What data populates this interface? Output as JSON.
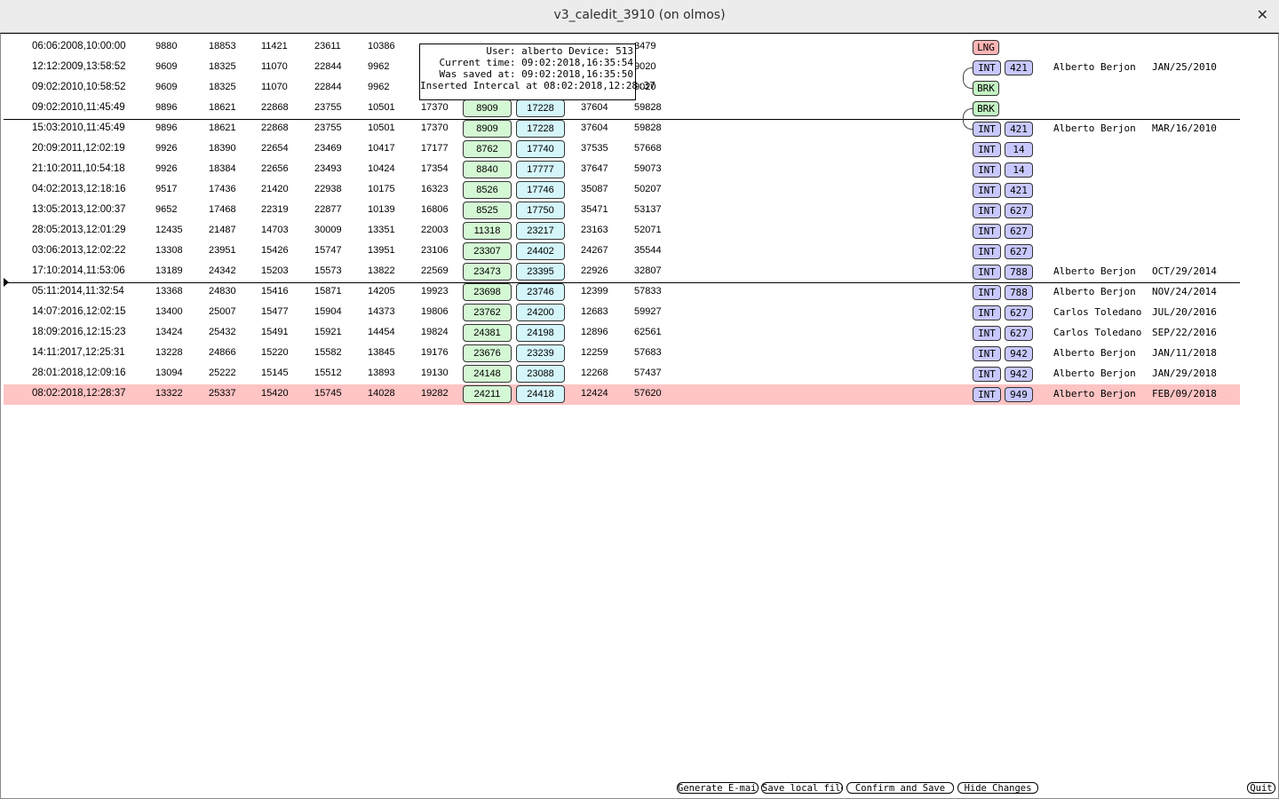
{
  "window": {
    "title": "v3_caledit_3910 (on olmos)",
    "close_glyph": "✕"
  },
  "tooltip": {
    "lines": [
      "User: alberto Device: 513",
      "Current time: 09:02:2018,16:35:54",
      "Was saved at: 09:02:2018,16:35:50",
      "Inserted Intercal at 08:02:2018,12:28:37"
    ]
  },
  "colors": {
    "selected_row": "#ffc4c4",
    "col6_box": "#d4f7d4",
    "col7_box": "#d4f5fa",
    "int_tag": "#c8c8ff",
    "lng_tag": "#ffb5b5",
    "brk_tag": "#c4f4c4"
  },
  "rows": [
    {
      "date": "06:06:2008,10:00:00",
      "vals": [
        "9880",
        "18853",
        "11421",
        "23611",
        "10386",
        "",
        "",
        "",
        "",
        "3479"
      ],
      "type": "LNG",
      "device": "",
      "user": "",
      "created": ""
    },
    {
      "date": "12:12:2009,13:58:52",
      "vals": [
        "9609",
        "18325",
        "11070",
        "22844",
        "9962",
        "",
        "",
        "",
        "",
        "9020"
      ],
      "type": "INT",
      "device": "421",
      "user": "Alberto Berjon",
      "created": "JAN/25/2010"
    },
    {
      "date": "09:02:2010,10:58:52",
      "vals": [
        "9609",
        "18325",
        "11070",
        "22844",
        "9962",
        "",
        "",
        "",
        "",
        "9020"
      ],
      "type": "BRK",
      "device": "",
      "user": "",
      "created": ""
    },
    {
      "date": "09:02:2010,11:45:49",
      "vals": [
        "9896",
        "18621",
        "22868",
        "23755",
        "10501",
        "17370",
        "8909",
        "17228",
        "37604",
        "59828"
      ],
      "type": "BRK",
      "device": "",
      "user": "",
      "created": ""
    },
    {
      "date": "15:03:2010,11:45:49",
      "vals": [
        "9896",
        "18621",
        "22868",
        "23755",
        "10501",
        "17370",
        "8909",
        "17228",
        "37604",
        "59828"
      ],
      "type": "INT",
      "device": "421",
      "user": "Alberto Berjon",
      "created": "MAR/16/2010"
    },
    {
      "date": "20:09:2011,12:02:19",
      "vals": [
        "9926",
        "18390",
        "22654",
        "23469",
        "10417",
        "17177",
        "8762",
        "17740",
        "37535",
        "57668"
      ],
      "type": "INT",
      "device": "14",
      "user": "",
      "created": ""
    },
    {
      "date": "21:10:2011,10:54:18",
      "vals": [
        "9926",
        "18384",
        "22656",
        "23493",
        "10424",
        "17354",
        "8840",
        "17777",
        "37647",
        "59073"
      ],
      "type": "INT",
      "device": "14",
      "user": "",
      "created": ""
    },
    {
      "date": "04:02:2013,12:18:16",
      "vals": [
        "9517",
        "17436",
        "21420",
        "22938",
        "10175",
        "16323",
        "8526",
        "17746",
        "35087",
        "50207"
      ],
      "type": "INT",
      "device": "421",
      "user": "",
      "created": ""
    },
    {
      "date": "13:05:2013,12:00:37",
      "vals": [
        "9652",
        "17468",
        "22319",
        "22877",
        "10139",
        "16806",
        "8525",
        "17750",
        "35471",
        "53137"
      ],
      "type": "INT",
      "device": "627",
      "user": "",
      "created": ""
    },
    {
      "date": "28:05:2013,12:01:29",
      "vals": [
        "12435",
        "21487",
        "14703",
        "30009",
        "13351",
        "22003",
        "11318",
        "23217",
        "23163",
        "52071"
      ],
      "type": "INT",
      "device": "627",
      "user": "",
      "created": ""
    },
    {
      "date": "03:06:2013,12:02:22",
      "vals": [
        "13308",
        "23951",
        "15426",
        "15747",
        "13951",
        "23106",
        "23307",
        "24402",
        "24267",
        "35544"
      ],
      "type": "INT",
      "device": "627",
      "user": "",
      "created": ""
    },
    {
      "date": "17:10:2014,11:53:06",
      "vals": [
        "13189",
        "24342",
        "15203",
        "15573",
        "13822",
        "22569",
        "23473",
        "23395",
        "22926",
        "32807"
      ],
      "type": "INT",
      "device": "788",
      "user": "Alberto Berjon",
      "created": "OCT/29/2014"
    },
    {
      "date": "05:11:2014,11:32:54",
      "vals": [
        "13368",
        "24830",
        "15416",
        "15871",
        "14205",
        "19923",
        "23698",
        "23746",
        "12399",
        "57833"
      ],
      "type": "INT",
      "device": "788",
      "user": "Alberto Berjon",
      "created": "NOV/24/2014"
    },
    {
      "date": "14:07:2016,12:02:15",
      "vals": [
        "13400",
        "25007",
        "15477",
        "15904",
        "14373",
        "19806",
        "23762",
        "24200",
        "12683",
        "59927"
      ],
      "type": "INT",
      "device": "627",
      "user": "Carlos Toledano",
      "created": "JUL/20/2016"
    },
    {
      "date": "18:09:2016,12:15:23",
      "vals": [
        "13424",
        "25432",
        "15491",
        "15921",
        "14454",
        "19824",
        "24381",
        "24198",
        "12896",
        "62561"
      ],
      "type": "INT",
      "device": "627",
      "user": "Carlos Toledano",
      "created": "SEP/22/2016"
    },
    {
      "date": "14:11:2017,12:25:31",
      "vals": [
        "13228",
        "24866",
        "15220",
        "15582",
        "13845",
        "19176",
        "23676",
        "23239",
        "12259",
        "57683"
      ],
      "type": "INT",
      "device": "942",
      "user": "Alberto Berjon",
      "created": "JAN/11/2018"
    },
    {
      "date": "28:01:2018,12:09:16",
      "vals": [
        "13094",
        "25222",
        "15145",
        "15512",
        "13893",
        "19130",
        "24148",
        "23088",
        "12268",
        "57437"
      ],
      "type": "INT",
      "device": "942",
      "user": "Alberto Berjon",
      "created": "JAN/29/2018"
    },
    {
      "date": "08:02:2018,12:28:37",
      "vals": [
        "13322",
        "25337",
        "15420",
        "15745",
        "14028",
        "19282",
        "24211",
        "24418",
        "12424",
        "57620"
      ],
      "type": "INT",
      "device": "949",
      "user": "Alberto Berjon",
      "created": "FEB/09/2018",
      "selected": true
    }
  ],
  "toolbar": {
    "generate_email": "Generate E-mail",
    "save_local": "Save local file",
    "confirm_save": "Confirm and Save",
    "hide_changes": "Hide Changes",
    "quit": "Quit"
  }
}
